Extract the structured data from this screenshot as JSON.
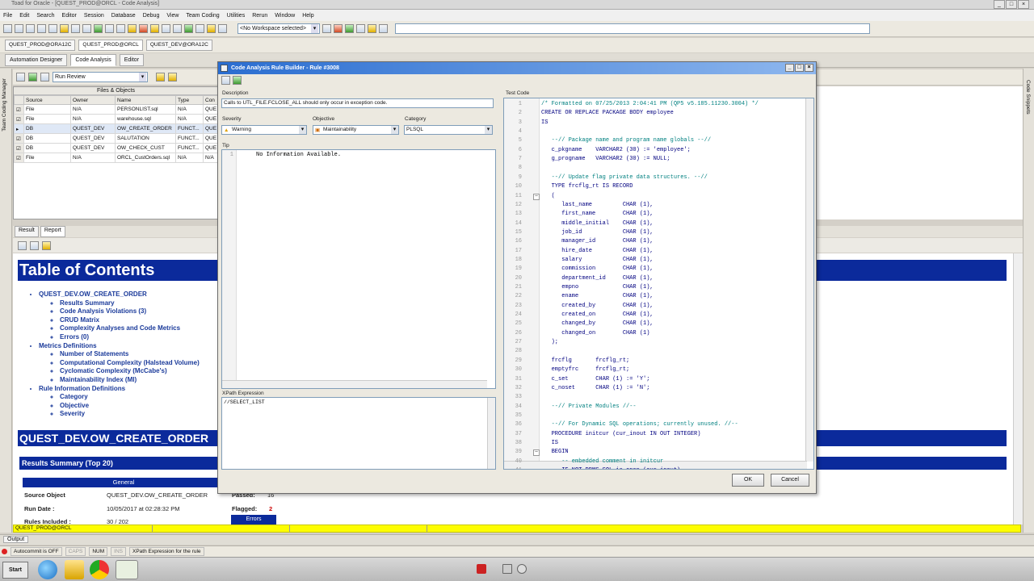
{
  "app": {
    "title": "Toad for Oracle - [QUEST_PROD@ORCL - Code Analysis]",
    "window_controls": [
      "_",
      "□",
      "×"
    ]
  },
  "menu": [
    "File",
    "Edit",
    "Search",
    "Editor",
    "Session",
    "Database",
    "Debug",
    "View",
    "Team Coding",
    "Utilities",
    "Rerun",
    "Window",
    "Help"
  ],
  "toolbar": {
    "workspace": "<No Workspace selected>"
  },
  "connections": [
    "QUEST_PROD@ORA12C",
    "QUEST_PROD@ORCL",
    "QUEST_DEV@ORA12C"
  ],
  "window_tabs": [
    "Automation Designer",
    "Code Analysis",
    "Editor"
  ],
  "left_strip": [
    "Team Coding Manager"
  ],
  "right_strip": [
    "Code Snippets"
  ],
  "review": {
    "label": "Run Review"
  },
  "files_objects": {
    "title": "Files & Objects",
    "columns": [
      "Source",
      "Owner",
      "Name",
      "Type",
      "Con"
    ],
    "rows": [
      [
        "File",
        "N/A",
        "PERSONLIST.sql",
        "N/A",
        "QUE"
      ],
      [
        "File",
        "N/A",
        "warehouse.sql",
        "N/A",
        "QUE"
      ],
      [
        "DB",
        "QUEST_DEV",
        "OW_CREATE_ORDER",
        "FUNCT...",
        "QUE"
      ],
      [
        "DB",
        "QUEST_DEV",
        "SALUTATION",
        "FUNCT...",
        "QUE"
      ],
      [
        "DB",
        "QUEST_DEV",
        "OW_CHECK_CUST",
        "FUNCT...",
        "QUE"
      ],
      [
        "File",
        "N/A",
        "ORCL_CustOrders.sql",
        "N/A",
        "N/A"
      ]
    ]
  },
  "result_tabs": [
    "Result",
    "Report"
  ],
  "report": {
    "toc_title": "Table of Contents",
    "toc": [
      {
        "label": "QUEST_DEV.OW_CREATE_ORDER",
        "children": [
          "Results Summary",
          "Code Analysis Violations (3)",
          "CRUD Matrix",
          "Complexity Analyses and Code Metrics",
          "Errors (0)"
        ]
      },
      {
        "label": "Metrics Definitions",
        "children": [
          "Number of Statements",
          "Computational Complexity (Halstead Volume)",
          "Cyclomatic Complexity (McCabe's)",
          "Maintainability Index (MI)"
        ]
      },
      {
        "label": "Rule Information Definitions",
        "children": [
          "Category",
          "Objective",
          "Severity"
        ]
      }
    ],
    "section_title": "QUEST_DEV.OW_CREATE_ORDER",
    "summary_title": "Results Summary (Top 20)",
    "general_label": "General",
    "source_object_label": "Source Object",
    "source_object_value": "QUEST_DEV.OW_CREATE_ORDER",
    "run_date_label": "Run Date :",
    "run_date_value": "10/05/2017 at 02:28:32 PM",
    "rules_label": "Rules Included :",
    "rules_value": "30 / 202",
    "passed_label": "Passed:",
    "passed_value": "16",
    "flagged_label": "Flagged:",
    "flagged_value": "2",
    "errors_label": "Errors"
  },
  "status_strip": "QUEST_PROD@ORCL",
  "output_tab": "Output",
  "status": {
    "autocommit": "Autocommit is OFF",
    "caps": "CAPS",
    "num": "NUM",
    "ins": "INS",
    "hint": "XPath Expression for the rule"
  },
  "taskbar": {
    "start": "Start"
  },
  "dialog": {
    "title": "Code Analysis Rule Builder - Rule #3008",
    "description_label": "Description",
    "description": "Calls to UTL_FILE.FCLOSE_ALL should only occur in exception code.",
    "severity_label": "Severity",
    "severity": "Warning",
    "objective_label": "Objective",
    "objective": "Maintainability",
    "category_label": "Category",
    "category": "PLSQL",
    "tip_label": "Tip",
    "tip_text": "No Information Available.",
    "xpath_label": "XPath Expression",
    "xpath_text": "//SELECT_LIST",
    "testcode_label": "Test Code",
    "ok": "OK",
    "cancel": "Cancel",
    "code_lines": [
      {
        "n": "1",
        "t": "/* Formatted on 07/25/2013 2:04:41 PM (QP5 v5.185.11230.3004) */",
        "k": "cm"
      },
      {
        "n": "2",
        "t": "CREATE OR REPLACE PACKAGE BODY employee",
        "k": "bl"
      },
      {
        "n": "3",
        "t": "IS",
        "k": "bl"
      },
      {
        "n": "4",
        "t": "",
        "k": ""
      },
      {
        "n": "5",
        "t": "   --// Package name and program name globals --//",
        "k": "cm"
      },
      {
        "n": "6",
        "t": "   c_pkgname    VARCHAR2 (30) := 'employee';",
        "k": "bl"
      },
      {
        "n": "7",
        "t": "   g_progname   VARCHAR2 (30) := NULL;",
        "k": "bl"
      },
      {
        "n": "8",
        "t": "",
        "k": ""
      },
      {
        "n": "9",
        "t": "   --// Update flag private data structures. --//",
        "k": "cm"
      },
      {
        "n": "10",
        "t": "   TYPE frcflg_rt IS RECORD",
        "k": "bl"
      },
      {
        "n": "11",
        "t": "   (",
        "k": "bl"
      },
      {
        "n": "12",
        "t": "      last_name         CHAR (1),",
        "k": "bl"
      },
      {
        "n": "13",
        "t": "      first_name        CHAR (1),",
        "k": "bl"
      },
      {
        "n": "14",
        "t": "      middle_initial    CHAR (1),",
        "k": "bl"
      },
      {
        "n": "15",
        "t": "      job_id            CHAR (1),",
        "k": "bl"
      },
      {
        "n": "16",
        "t": "      manager_id        CHAR (1),",
        "k": "bl"
      },
      {
        "n": "17",
        "t": "      hire_date         CHAR (1),",
        "k": "bl"
      },
      {
        "n": "18",
        "t": "      salary            CHAR (1),",
        "k": "bl"
      },
      {
        "n": "19",
        "t": "      commission        CHAR (1),",
        "k": "bl"
      },
      {
        "n": "20",
        "t": "      department_id     CHAR (1),",
        "k": "bl"
      },
      {
        "n": "21",
        "t": "      empno             CHAR (1),",
        "k": "bl"
      },
      {
        "n": "22",
        "t": "      ename             CHAR (1),",
        "k": "bl"
      },
      {
        "n": "23",
        "t": "      created_by        CHAR (1),",
        "k": "bl"
      },
      {
        "n": "24",
        "t": "      created_on        CHAR (1),",
        "k": "bl"
      },
      {
        "n": "25",
        "t": "      changed_by        CHAR (1),",
        "k": "bl"
      },
      {
        "n": "26",
        "t": "      changed_on        CHAR (1)",
        "k": "bl"
      },
      {
        "n": "27",
        "t": "   );",
        "k": "bl"
      },
      {
        "n": "28",
        "t": "",
        "k": ""
      },
      {
        "n": "29",
        "t": "   frcflg       frcflg_rt;",
        "k": "bl"
      },
      {
        "n": "30",
        "t": "   emptyfrc     frcflg_rt;",
        "k": "bl"
      },
      {
        "n": "31",
        "t": "   c_set        CHAR (1) := 'Y';",
        "k": "bl"
      },
      {
        "n": "32",
        "t": "   c_noset      CHAR (1) := 'N';",
        "k": "bl"
      },
      {
        "n": "33",
        "t": "",
        "k": ""
      },
      {
        "n": "34",
        "t": "   --// Private Modules //--",
        "k": "cm"
      },
      {
        "n": "35",
        "t": "",
        "k": ""
      },
      {
        "n": "36",
        "t": "   --// For Dynamic SQL operations; currently unused. //--",
        "k": "cm"
      },
      {
        "n": "37",
        "t": "   PROCEDURE initcur (cur_inout IN OUT INTEGER)",
        "k": "bl"
      },
      {
        "n": "38",
        "t": "   IS",
        "k": "bl"
      },
      {
        "n": "39",
        "t": "   BEGIN",
        "k": "bl"
      },
      {
        "n": "40",
        "t": "      -- embedded comment in initcur",
        "k": "cm"
      },
      {
        "n": "41",
        "t": "      IF NOT DBMS_SQL.is_open (cur_inout)",
        "k": "bl"
      }
    ],
    "fold_lines": [
      "11",
      "39"
    ]
  }
}
